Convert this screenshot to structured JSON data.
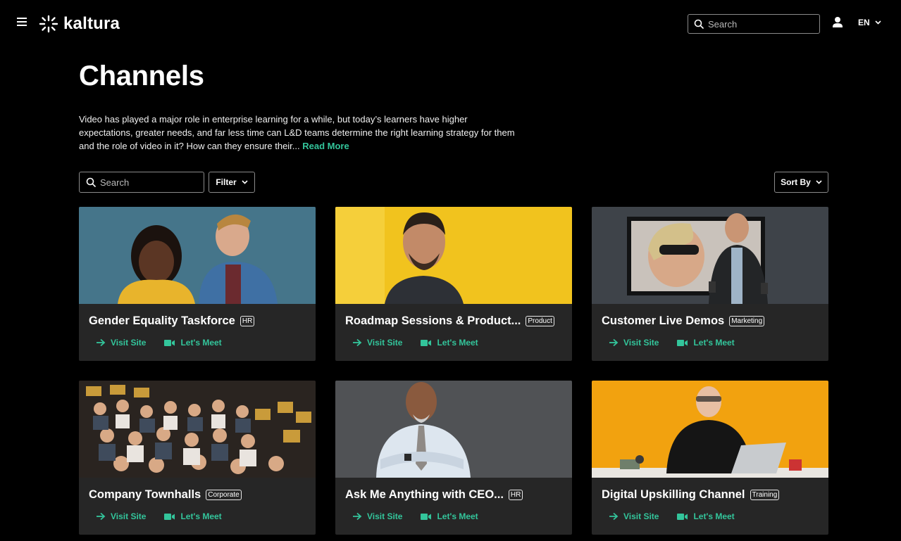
{
  "header": {
    "brand": "kaltura",
    "search_placeholder": "Search",
    "language": "EN"
  },
  "page": {
    "title": "Channels",
    "description": "Video has played a major role in enterprise learning for a while, but today’s learners have higher expectations, greater needs, and far less time can L&D teams determine the right learning strategy for them and the role of video in it? How can they ensure their...",
    "read_more": "Read More"
  },
  "controls": {
    "search_placeholder": "Search",
    "filter_label": "Filter",
    "sort_label": "Sort By"
  },
  "channels": [
    {
      "title": "Gender Equality Taskforce",
      "tag": "HR",
      "visit": "Visit Site",
      "meet": "Let's Meet"
    },
    {
      "title": "Roadmap Sessions & Product...",
      "tag": "Product",
      "visit": "Visit Site",
      "meet": "Let's Meet"
    },
    {
      "title": "Customer Live Demos",
      "tag": "Marketing",
      "visit": "Visit Site",
      "meet": "Let's Meet"
    },
    {
      "title": "Company Townhalls",
      "tag": "Corporate",
      "visit": "Visit Site",
      "meet": "Let's Meet"
    },
    {
      "title": "Ask Me Anything with CEO...",
      "tag": "HR",
      "visit": "Visit Site",
      "meet": "Let's Meet"
    },
    {
      "title": "Digital Upskilling Channel",
      "tag": "Training",
      "visit": "Visit Site",
      "meet": "Let's Meet"
    }
  ],
  "colors": {
    "accent": "#33c59b",
    "background": "#000000",
    "card": "#262626"
  },
  "icons": [
    "menu-icon",
    "kaltura-logo-icon",
    "search-icon",
    "user-icon",
    "chevron-down-icon",
    "arrow-right-icon",
    "video-camera-icon"
  ]
}
